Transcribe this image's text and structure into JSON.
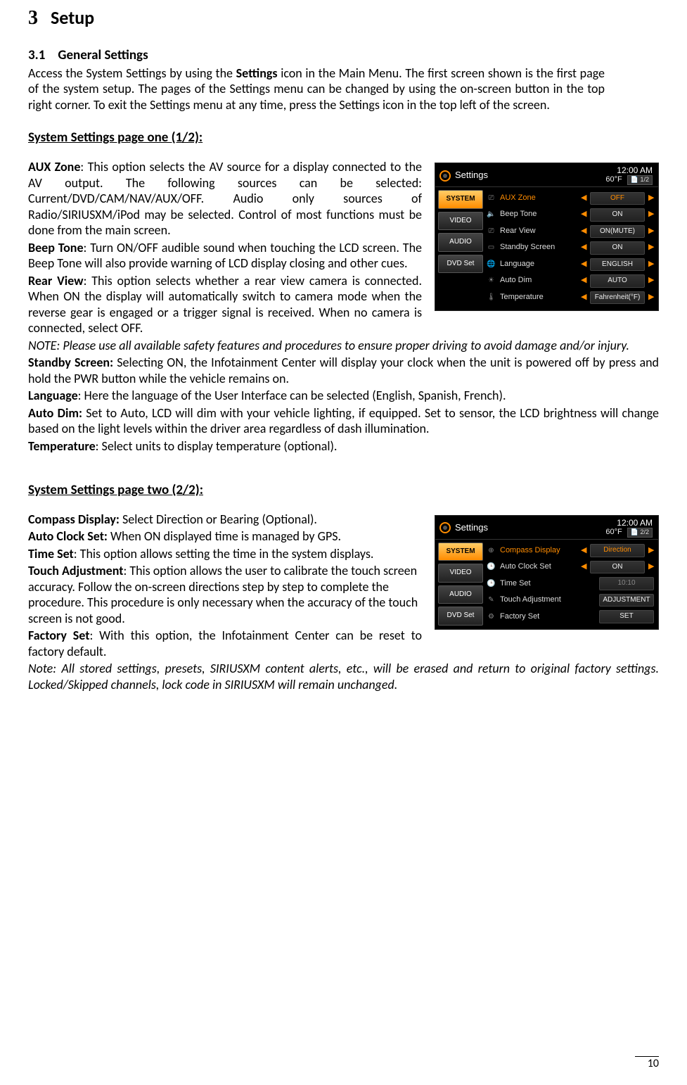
{
  "heading": {
    "num": "3",
    "title": "Setup"
  },
  "section": {
    "num": "3.1",
    "title": "General Settings"
  },
  "intro": "Access the System Settings by using the Settings icon in the Main Menu. The first screen shown is the first page of the system setup. The pages of the Settings menu can be changed by using the on-screen button in the top right corner. To exit the Settings menu at any time, press  the Settings icon in the top left of the screen.",
  "intro_bold": "Settings",
  "page1": {
    "heading": "System Settings page one (1/2):",
    "aux_zone_label": "AUX Zone",
    "aux_zone_text": ": This option selects the AV source for a display connected to the AV output. The following sources can be selected: Current/DVD/CAM/NAV/AUX/OFF. Audio only sources of Radio/SIRIUSXM/iPod may be selected. Control of most functions must be done from the main screen.",
    "beep_label": "Beep Tone",
    "beep_text": ": Turn ON/OFF audible sound when touching the LCD screen. The Beep Tone will also provide warning of LCD display closing and other cues.",
    "rear_label": "Rear View",
    "rear_text": ": This option selects whether a rear view camera is connected. When ON the display will automatically switch to camera mode when the reverse gear is engaged or a trigger signal is received. When no camera is connected, select OFF.",
    "note": "NOTE: Please use all available safety features and procedures to ensure proper driving to avoid damage and/or injury.",
    "standby_label": "Standby Screen:",
    "standby_text": " Selecting ON, the Infotainment Center will display your clock when the unit is powered off by press and hold the PWR button while the vehicle remains on.",
    "language_label": "Language",
    "language_text": ": Here the language of the User Interface can be selected (English, Spanish, French).",
    "autodim_label": "Auto Dim:",
    "autodim_text": " Set to Auto, LCD will dim with your vehicle lighting, if equipped. Set to sensor, the LCD brightness will change based on the light levels within the driver area regardless of dash illumination.",
    "temp_label": "Temperature",
    "temp_text": ": Select units to display temperature (optional)."
  },
  "page2": {
    "heading": "System Settings page two (2/2):",
    "compass_label": "Compass Display:",
    "compass_text": " Select Direction or Bearing (Optional).",
    "autoclock_label": "Auto Clock Set:",
    "autoclock_text": " When ON displayed time is managed by GPS.",
    "timeset_label": "Time Set",
    "timeset_text": ": This option allows setting the time in the system displays.",
    "touch_label": "Touch Adjustment",
    "touch_text": ": This option allows the user to calibrate the touch screen accuracy. Follow the on-screen directions step by step to complete the procedure. This procedure is only necessary when the accuracy of the touch screen is not good.",
    "factory_label": "Factory Set",
    "factory_text": ": With this option, the Infotainment Center can be reset to factory default.",
    "note": "Note: All stored settings, presets, SIRIUSXM content alerts, etc., will be erased and return to original factory settings. Locked/Skipped channels, lock code in SIRIUSXM will remain unchanged."
  },
  "device_common": {
    "title": "Settings",
    "time": "12:00  AM",
    "temp": "60°F",
    "sidebar": [
      "SYSTEM",
      "VIDEO",
      "AUDIO",
      "DVD Set"
    ]
  },
  "device1": {
    "badge": "1/2",
    "rows": [
      {
        "icon": "⎚",
        "label": "AUX Zone",
        "value": "OFF",
        "arrows": true,
        "selected": true
      },
      {
        "icon": "🔈",
        "label": "Beep Tone",
        "value": "ON",
        "arrows": true
      },
      {
        "icon": "⎚",
        "label": "Rear View",
        "value": "ON(MUTE)",
        "arrows": true
      },
      {
        "icon": "▭",
        "label": "Standby Screen",
        "value": "ON",
        "arrows": true
      },
      {
        "icon": "🌐",
        "label": "Language",
        "value": "ENGLISH",
        "arrows": true
      },
      {
        "icon": "☀",
        "label": "Auto Dim",
        "value": "AUTO",
        "arrows": true
      },
      {
        "icon": "🌡",
        "label": "Temperature",
        "value": "Fahrenheit(°F)",
        "arrows": true
      }
    ]
  },
  "device2": {
    "badge": "2/2",
    "rows": [
      {
        "icon": "⊕",
        "label": "Compass Display",
        "value": "Direction",
        "arrows": true,
        "selected": true
      },
      {
        "icon": "🕒",
        "label": "Auto Clock Set",
        "value": "ON",
        "arrows": true
      },
      {
        "icon": "🕒",
        "label": "Time Set",
        "value": "10:10",
        "arrows": false,
        "dim": true
      },
      {
        "icon": "✎",
        "label": "Touch Adjustment",
        "value": "ADJUSTMENT",
        "arrows": false
      },
      {
        "icon": "⚙",
        "label": "Factory Set",
        "value": "SET",
        "arrows": false
      }
    ]
  },
  "page_number": "10"
}
